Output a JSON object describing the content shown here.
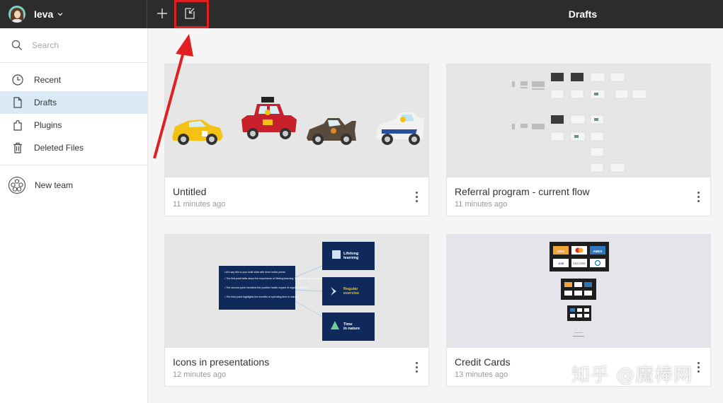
{
  "header": {
    "user_name": "Ieva",
    "title": "Drafts",
    "new_icon": "plus-icon",
    "import_icon": "import-file-icon"
  },
  "sidebar": {
    "search_placeholder": "Search",
    "items": [
      {
        "label": "Recent",
        "icon": "clock-icon",
        "active": false
      },
      {
        "label": "Drafts",
        "icon": "file-icon",
        "active": true
      },
      {
        "label": "Plugins",
        "icon": "plugin-icon",
        "active": false
      },
      {
        "label": "Deleted Files",
        "icon": "trash-icon",
        "active": false
      }
    ],
    "team": {
      "label": "New team",
      "icon": "team-icon"
    }
  },
  "files": [
    {
      "name": "Untitled",
      "meta": "11 minutes ago"
    },
    {
      "name": "Referral program - current flow",
      "meta": "11 minutes ago"
    },
    {
      "name": "Icons in presentations",
      "meta": "12 minutes ago"
    },
    {
      "name": "Credit Cards",
      "meta": "13 minutes ago"
    }
  ],
  "thumbnails": {
    "presentation": {
      "slide_heading": "Let's say this is your draft slide with three bullet points.",
      "slide_bullets": [
        "• The first point talks about the importance of lifelong learning. It contains two sentences.",
        "• The second point mentions the positive health impact of regular exercise.",
        "• The third point highlights the benefits of spending time in nature."
      ],
      "cards": [
        {
          "line1": "Lifelong",
          "line2": "learning"
        },
        {
          "line1": "Regular",
          "line2": "exercise"
        },
        {
          "line1": "Time",
          "line2": "in nature"
        }
      ]
    },
    "credit_cards": {
      "row1": [
        "VISA",
        "",
        "AMEX"
      ],
      "row2": [
        "JCB",
        "DISCOVER",
        ""
      ]
    }
  },
  "watermark": "知乎 @魔棒网",
  "colors": {
    "topbar": "#2c2c2c",
    "active_item": "#daebf7",
    "annotation_red": "#e02020",
    "slide_navy": "#0f2a5a"
  }
}
